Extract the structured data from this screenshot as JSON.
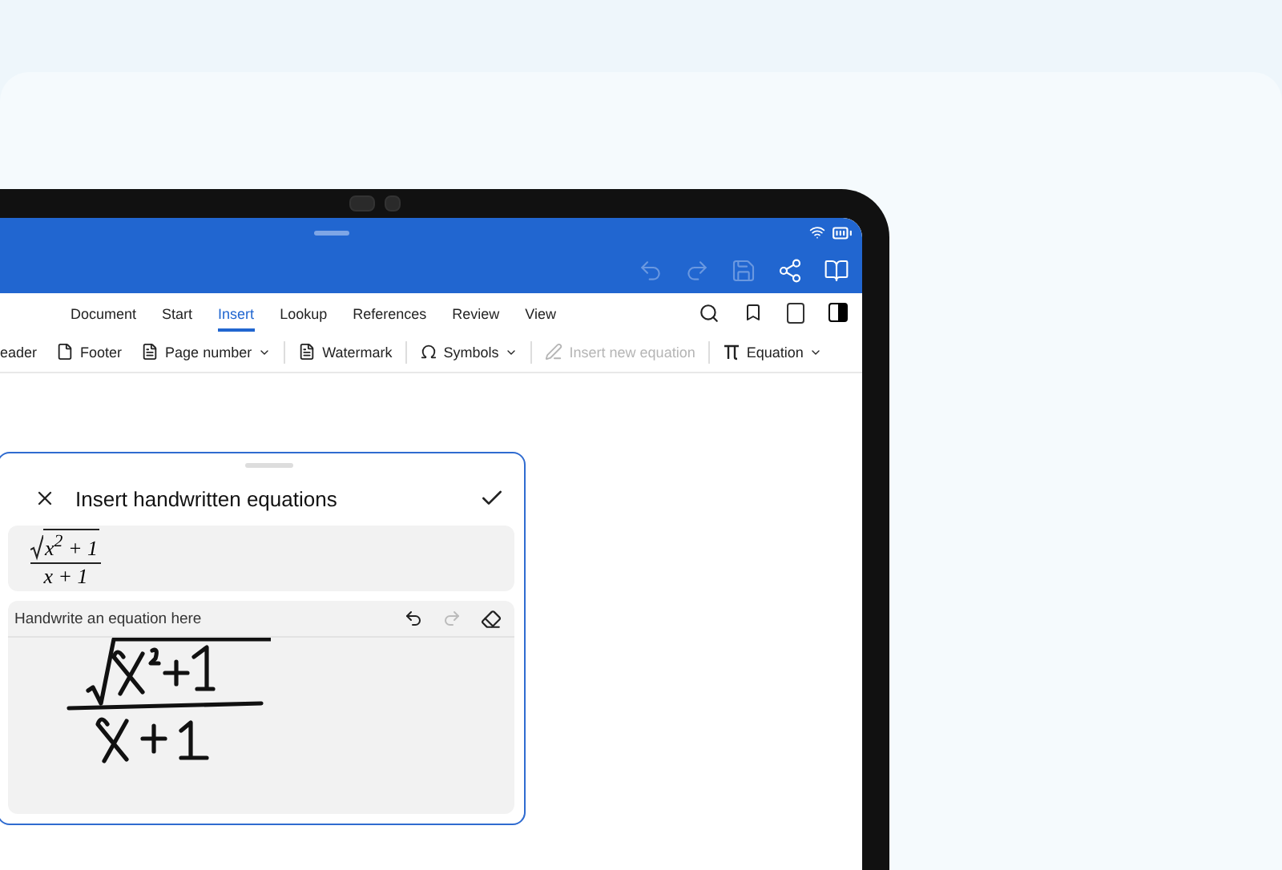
{
  "header": {
    "actions": [
      {
        "kind": "undo",
        "disabled": true
      },
      {
        "kind": "redo",
        "disabled": true
      },
      {
        "kind": "save",
        "disabled": true
      },
      {
        "kind": "share",
        "disabled": false
      },
      {
        "kind": "book",
        "disabled": false
      }
    ]
  },
  "tabs": [
    {
      "label": "Document",
      "selected": false
    },
    {
      "label": "Start",
      "selected": false
    },
    {
      "label": "Insert",
      "selected": true
    },
    {
      "label": "Lookup",
      "selected": false
    },
    {
      "label": "References",
      "selected": false
    },
    {
      "label": "Review",
      "selected": false
    },
    {
      "label": "View",
      "selected": false
    }
  ],
  "toolbar": {
    "groups": [
      [
        {
          "kind": "header",
          "label": "eader",
          "dropdown": false,
          "disabled": false
        },
        {
          "kind": "footer",
          "label": "Footer",
          "dropdown": false,
          "disabled": false
        },
        {
          "kind": "pagenumber",
          "label": "Page number",
          "dropdown": true,
          "disabled": false
        }
      ],
      [
        {
          "kind": "watermark",
          "label": "Watermark",
          "dropdown": false,
          "disabled": false
        }
      ],
      [
        {
          "kind": "symbols",
          "label": "Symbols",
          "dropdown": true,
          "disabled": false
        }
      ],
      [
        {
          "kind": "inkeq",
          "label": "Insert new equation",
          "dropdown": false,
          "disabled": true
        }
      ],
      [
        {
          "kind": "equation",
          "label": "Equation",
          "dropdown": true,
          "disabled": false
        }
      ]
    ]
  },
  "panel": {
    "title": "Insert handwritten equations",
    "preview": {
      "numerator": "x$^{2}$ + 1",
      "denominator": "x + 1"
    },
    "ink_area": {
      "hint": "Handwrite an equation here",
      "undo_disabled": false,
      "redo_disabled": true
    }
  }
}
